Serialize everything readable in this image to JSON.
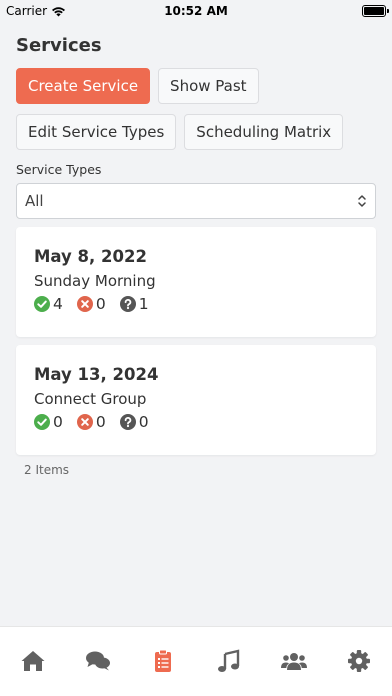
{
  "status_bar": {
    "carrier": "Carrier",
    "time": "10:52 AM"
  },
  "page": {
    "title": "Services"
  },
  "buttons": {
    "create_service": "Create Service",
    "show_past": "Show Past",
    "edit_service_types": "Edit Service Types",
    "scheduling_matrix": "Scheduling Matrix"
  },
  "filter": {
    "label": "Service Types",
    "selected": "All"
  },
  "services": [
    {
      "date": "May 8, 2022",
      "name": "Sunday Morning",
      "accepted": "4",
      "declined": "0",
      "pending": "1"
    },
    {
      "date": "May 13, 2024",
      "name": "Connect Group",
      "accepted": "0",
      "declined": "0",
      "pending": "0"
    }
  ],
  "items_count": "2 Items",
  "colors": {
    "primary": "#ee6b50",
    "accepted": "#4cae4c",
    "declined": "#e0654c",
    "pending": "#555555",
    "tab_icon": "#616161"
  },
  "tabs": [
    {
      "icon": "home-icon"
    },
    {
      "icon": "chat-icon"
    },
    {
      "icon": "clipboard-icon",
      "active": true
    },
    {
      "icon": "music-icon"
    },
    {
      "icon": "users-icon"
    },
    {
      "icon": "gear-icon"
    }
  ]
}
